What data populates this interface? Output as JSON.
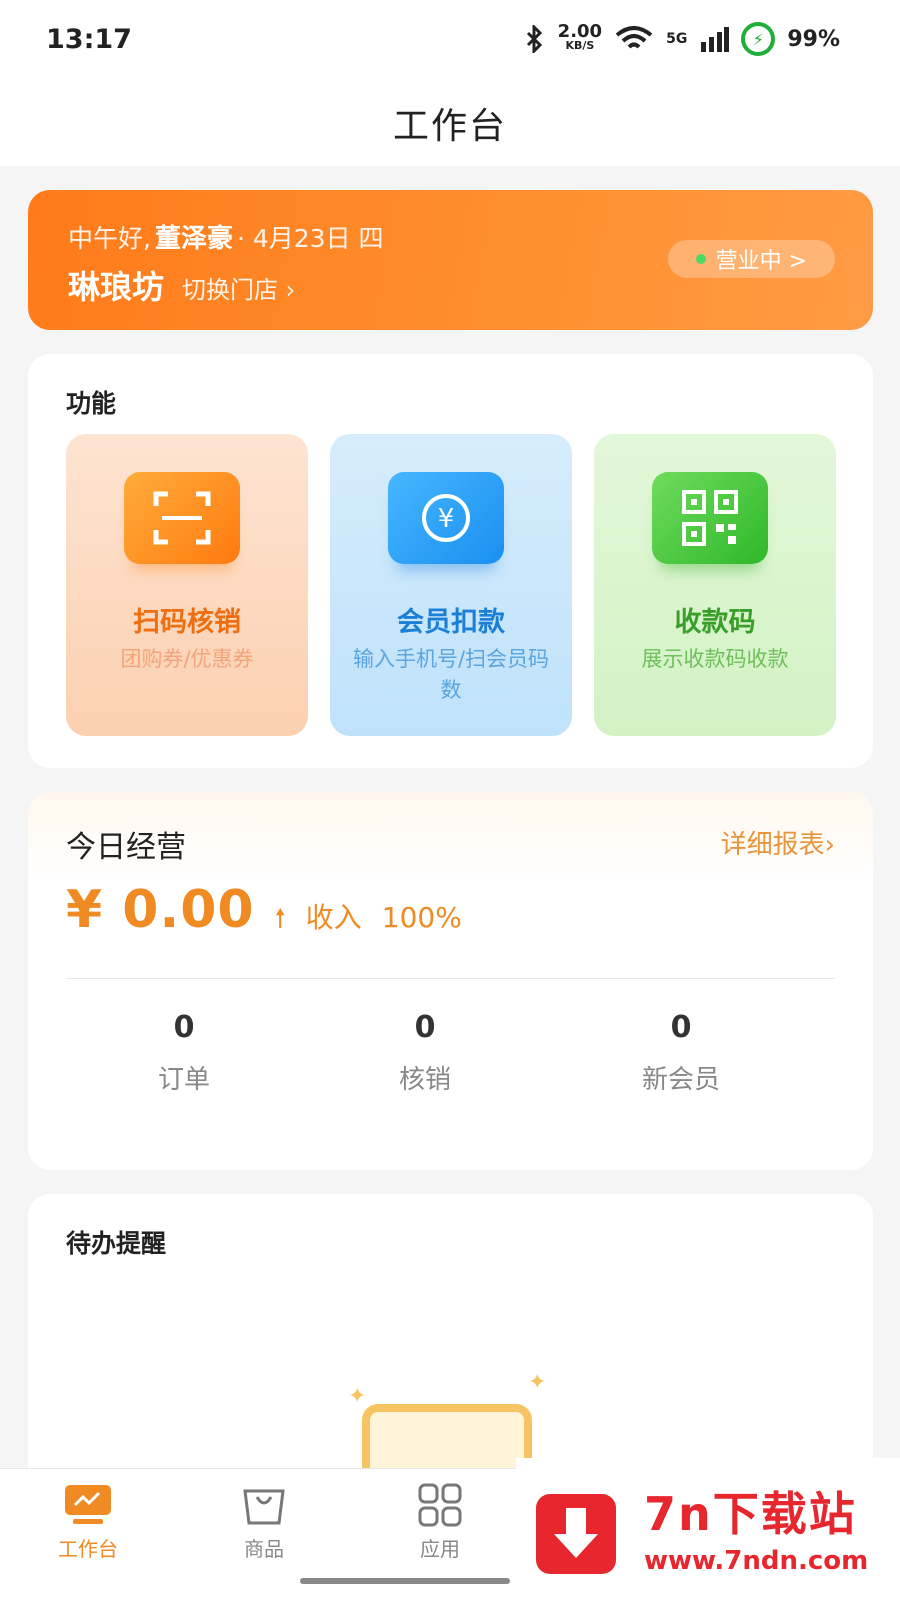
{
  "status_bar": {
    "time": "13:17",
    "speed_value": "2.00",
    "speed_unit": "KB/S",
    "network": "5G",
    "battery": "99%"
  },
  "header": {
    "title": "工作台"
  },
  "banner": {
    "greeting": "中午好,",
    "user_name": "董泽豪",
    "date": "· 4月23日 四",
    "store_name": "琳琅坊",
    "switch_store": "切换门店 ›",
    "status": "营业中 >"
  },
  "functions": {
    "title": "功能",
    "tiles": [
      {
        "title": "扫码核销",
        "subtitle": "团购券/优惠券",
        "icon": "scan-icon"
      },
      {
        "title": "会员扣款",
        "subtitle": "输入手机号/扫会员码数",
        "icon": "yuan-card-icon"
      },
      {
        "title": "收款码",
        "subtitle": "展示收款码收款",
        "icon": "qr-code-icon"
      }
    ]
  },
  "business": {
    "title": "今日经营",
    "report_link": "详细报表›",
    "amount": "¥ 0.00",
    "trend_arrow": "🠕",
    "income_label": "收入",
    "income_pct": "100%",
    "stats": [
      {
        "value": "0",
        "label": "订单"
      },
      {
        "value": "0",
        "label": "核销"
      },
      {
        "value": "0",
        "label": "新会员"
      }
    ]
  },
  "todo": {
    "title": "待办提醒"
  },
  "tabbar": {
    "tabs": [
      {
        "label": "工作台",
        "icon": "workbench-icon",
        "active": true
      },
      {
        "label": "商品",
        "icon": "shopping-bag-icon",
        "active": false
      },
      {
        "label": "应用",
        "icon": "apps-grid-icon",
        "active": false
      }
    ]
  },
  "watermark": {
    "title": "7n下载站",
    "url": "www.7ndn.com"
  },
  "colors": {
    "accent": "#f08a22",
    "banner": "#ff7a1a",
    "blue": "#1b7fd6",
    "green": "#3a9e2a"
  }
}
